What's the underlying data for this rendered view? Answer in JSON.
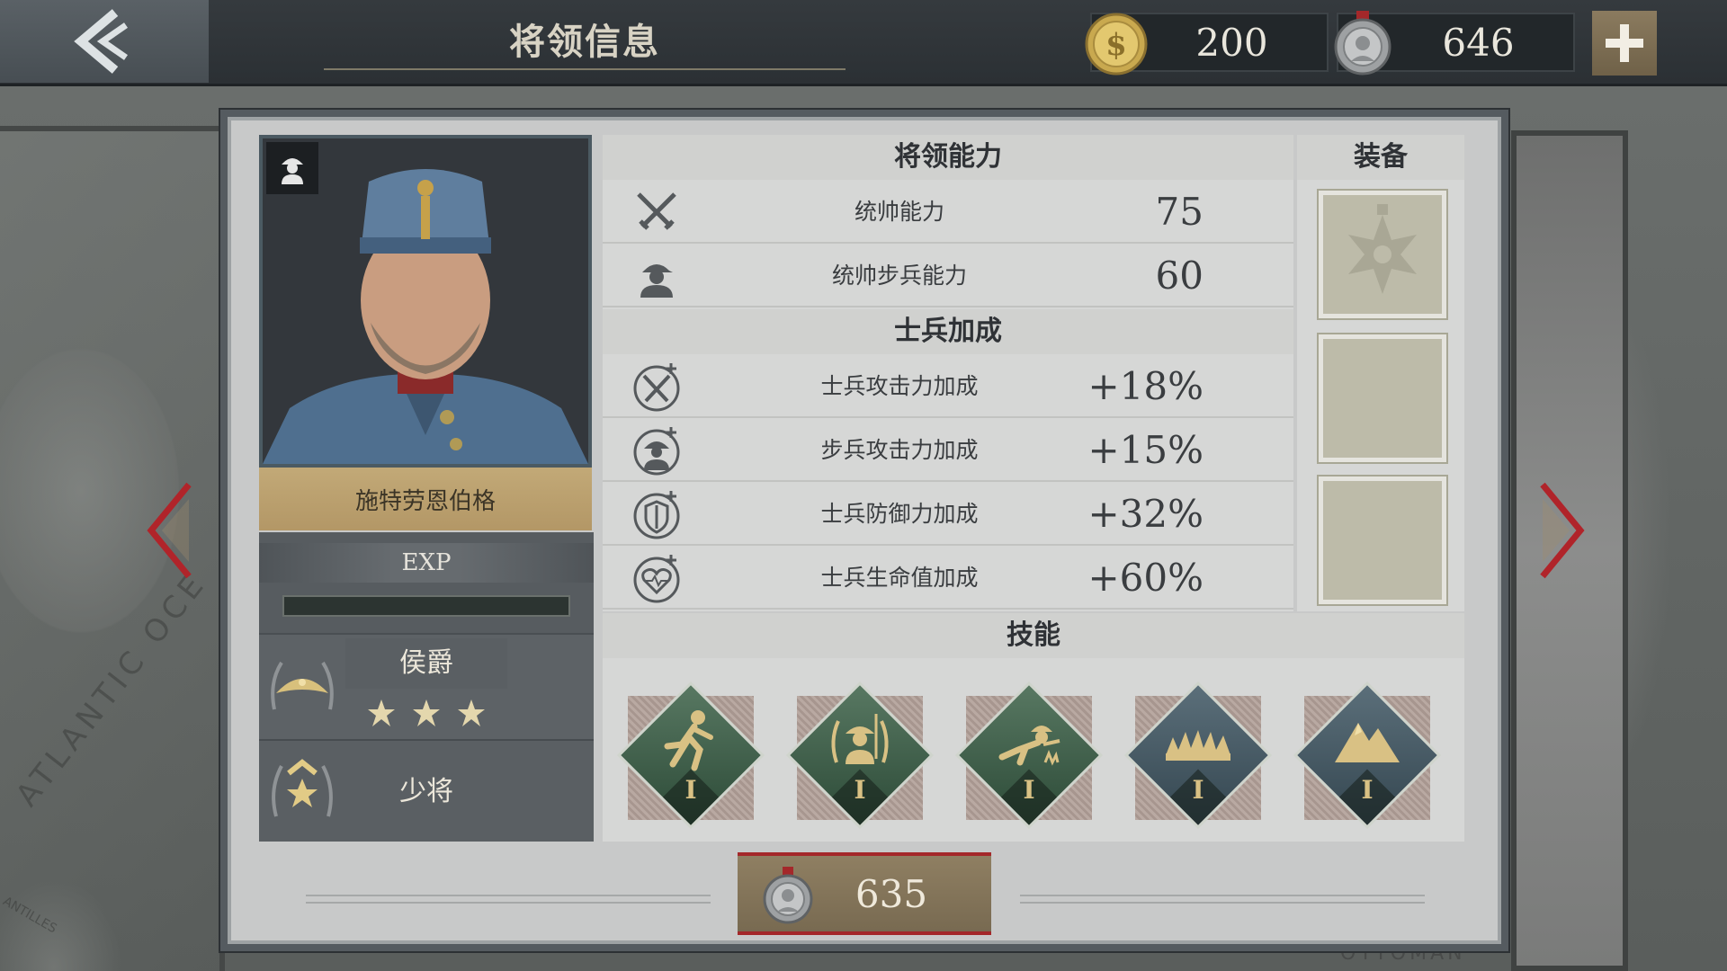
{
  "header": {
    "title": "将领信息",
    "back_icon": "back-arrow-icon",
    "currencies": [
      {
        "icon": "gold-coin-icon",
        "value": "200"
      },
      {
        "icon": "silver-medal-icon",
        "value": "646"
      }
    ],
    "add_icon": "plus-icon"
  },
  "general": {
    "name": "施特劳恩伯格",
    "exp_label": "EXP",
    "exp_fill": 0.0,
    "rank": "侯爵",
    "rank_stars": 3,
    "title": "少将"
  },
  "abilities": {
    "section_title": "将领能力",
    "rows": [
      {
        "icon": "crossed-swords-icon",
        "label": "统帅能力",
        "value": "75"
      },
      {
        "icon": "infantry-soldier-icon",
        "label": "统帅步兵能力",
        "value": "60"
      }
    ]
  },
  "bonuses": {
    "section_title": "士兵加成",
    "rows": [
      {
        "icon": "attack-bonus-icon",
        "label": "士兵攻击力加成",
        "value": "+18%"
      },
      {
        "icon": "infantry-attack-bonus-icon",
        "label": "步兵攻击力加成",
        "value": "+15%"
      },
      {
        "icon": "defense-bonus-icon",
        "label": "士兵防御力加成",
        "value": "+32%"
      },
      {
        "icon": "health-bonus-icon",
        "label": "士兵生命值加成",
        "value": "+60%"
      }
    ]
  },
  "equipment": {
    "section_title": "装备",
    "slots": [
      {
        "icon": "order-medal-icon",
        "filled": false
      },
      {
        "icon": "",
        "filled": false
      },
      {
        "icon": "",
        "filled": false
      }
    ]
  },
  "skills": {
    "section_title": "技能",
    "items": [
      {
        "icon": "running-soldier-icon",
        "level": "I",
        "color": "green"
      },
      {
        "icon": "laurel-soldier-icon",
        "level": "I",
        "color": "green"
      },
      {
        "icon": "crawling-soldier-icon",
        "level": "I",
        "color": "green"
      },
      {
        "icon": "barbed-wire-icon",
        "level": "I",
        "color": "blue"
      },
      {
        "icon": "mountain-icon",
        "level": "I",
        "color": "blue"
      }
    ]
  },
  "footer": {
    "icon": "silver-medal-icon",
    "value": "635"
  },
  "colors": {
    "gold": "#d9c184",
    "accent_red": "#a4282a",
    "panel": "#c8c9c9"
  }
}
